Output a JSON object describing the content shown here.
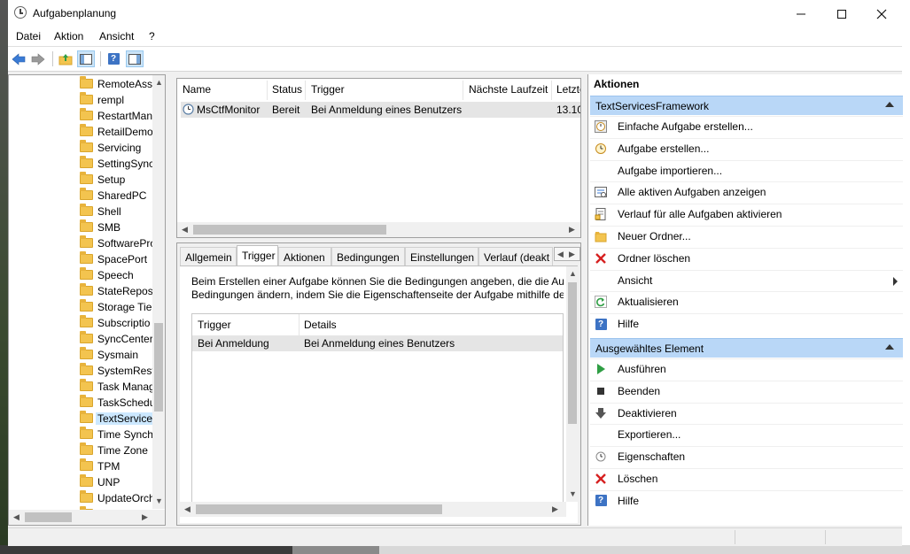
{
  "window": {
    "title": "Aufgabenplanung"
  },
  "menu": {
    "items": [
      "Datei",
      "Aktion",
      "Ansicht",
      "?"
    ]
  },
  "tree": {
    "items": [
      "RemoteAss",
      "rempl",
      "RestartMan",
      "RetailDemo",
      "Servicing",
      "SettingSync",
      "Setup",
      "SharedPC",
      "Shell",
      "SMB",
      "SoftwarePro",
      "SpacePort",
      "Speech",
      "StateReposi",
      "Storage Tier",
      "Subscriptio",
      "SyncCenter",
      "Sysmain",
      "SystemRest",
      "Task Manag",
      "TaskSchedu",
      "TextServices",
      "Time Synch",
      "Time Zone",
      "TPM",
      "UNP",
      "UpdateOrch",
      "UsoP"
    ],
    "selected_index": 21
  },
  "tasklist": {
    "columns": [
      "Name",
      "Status",
      "Trigger",
      "Nächste Laufzeit",
      "Letzte"
    ],
    "rows": [
      {
        "name": "MsCtfMonitor",
        "status": "Bereit",
        "trigger": "Bei Anmeldung eines Benutzers",
        "next": "",
        "last": "13.10"
      }
    ]
  },
  "detail": {
    "tabs": [
      "Allgemein",
      "Trigger",
      "Aktionen",
      "Bedingungen",
      "Einstellungen",
      "Verlauf (deakt"
    ],
    "active_tab": "Trigger",
    "description_line1": "Beim Erstellen einer Aufgabe können Sie die Bedingungen angeben, die die Aufg",
    "description_line2": "Bedingungen ändern, indem Sie die Eigenschaftenseite der Aufgabe mithilfe de",
    "trigger_table": {
      "columns": [
        "Trigger",
        "Details"
      ],
      "rows": [
        {
          "trigger": "Bei Anmeldung",
          "details": "Bei Anmeldung eines Benutzers"
        }
      ]
    }
  },
  "actions": {
    "title": "Aktionen",
    "section1": {
      "header": "TextServicesFramework",
      "items": [
        {
          "label": "Einfache Aufgabe erstellen...",
          "icon": "wizard-clock-icon"
        },
        {
          "label": "Aufgabe erstellen...",
          "icon": "clock-icon"
        },
        {
          "label": "Aufgabe importieren...",
          "icon": ""
        },
        {
          "label": "Alle aktiven Aufgaben anzeigen",
          "icon": "list-icon"
        },
        {
          "label": "Verlauf für alle Aufgaben aktivieren",
          "icon": "history-icon"
        },
        {
          "label": "Neuer Ordner...",
          "icon": "new-folder-icon"
        },
        {
          "label": "Ordner löschen",
          "icon": "delete-x-icon"
        },
        {
          "label": "Ansicht",
          "icon": ""
        },
        {
          "label": "Aktualisieren",
          "icon": "refresh-icon"
        },
        {
          "label": "Hilfe",
          "icon": "help-icon"
        }
      ]
    },
    "section2": {
      "header": "Ausgewähltes Element",
      "items": [
        {
          "label": "Ausführen",
          "icon": "play-icon"
        },
        {
          "label": "Beenden",
          "icon": "stop-icon"
        },
        {
          "label": "Deaktivieren",
          "icon": "down-arrow-icon"
        },
        {
          "label": "Exportieren...",
          "icon": ""
        },
        {
          "label": "Eigenschaften",
          "icon": "properties-clock-icon"
        },
        {
          "label": "Löschen",
          "icon": "delete-x-icon"
        },
        {
          "label": "Hilfe",
          "icon": "help-icon"
        }
      ]
    }
  },
  "colors": {
    "selection": "#cce8ff",
    "section_header": "#b9d7f7",
    "row_highlight": "#e5e5e5"
  }
}
